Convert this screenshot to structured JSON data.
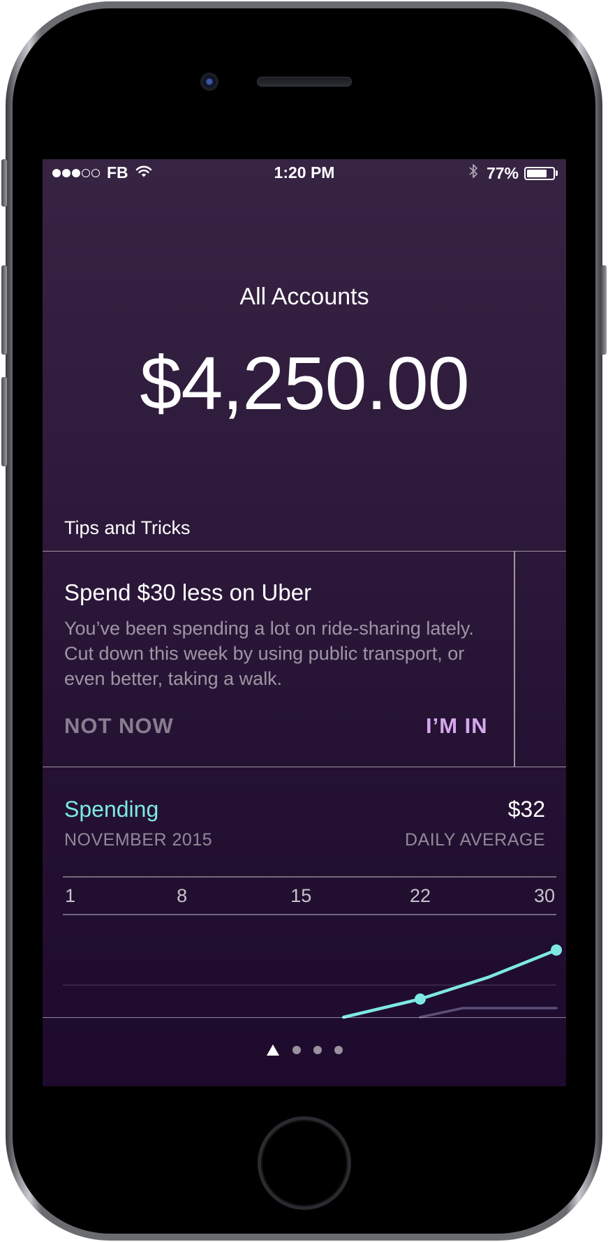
{
  "status_bar": {
    "carrier": "FB",
    "time": "1:20 PM",
    "battery_percent": "77%",
    "battery_level": 0.77,
    "signal_bars_filled": 3,
    "signal_bars_total": 5
  },
  "header": {
    "title": "All Accounts",
    "balance": "$4,250.00"
  },
  "tips": {
    "heading": "Tips and Tricks",
    "card": {
      "title": "Spend $30 less on Uber",
      "body": "You’ve been spending a lot on ride-sharing lately. Cut down this week by using public transport, or even better, taking a walk.",
      "dismiss_label": "NOT NOW",
      "accept_label": "I’M IN"
    }
  },
  "spending": {
    "title": "Spending",
    "amount": "$32",
    "period": "NOVEMBER 2015",
    "amount_label": "DAILY AVERAGE"
  },
  "colors": {
    "accent_teal": "#7ee8e2",
    "accent_purple": "#d6a8ee",
    "background_top": "#372443",
    "background_bottom": "#1d0a2c"
  },
  "chart_data": {
    "type": "line",
    "x_ticks": [
      "1",
      "8",
      "15",
      "22",
      "30"
    ],
    "x_range": [
      1,
      30
    ],
    "series": [
      {
        "role": "current",
        "color": "#7ee8e2",
        "points": [
          {
            "x": 17.5,
            "y": 0
          },
          {
            "x": 22,
            "y": 10
          },
          {
            "x": 26,
            "y": 22
          },
          {
            "x": 30,
            "y": 37
          }
        ],
        "markers": [
          22,
          30
        ]
      },
      {
        "role": "comparison",
        "color": "#5b4f78",
        "points": [
          {
            "x": 22,
            "y": 0
          },
          {
            "x": 24.5,
            "y": 5
          },
          {
            "x": 30,
            "y": 5
          }
        ],
        "markers": []
      }
    ]
  },
  "pager": {
    "pages": 4,
    "active": 0,
    "first_icon": "location-arrow-icon"
  }
}
